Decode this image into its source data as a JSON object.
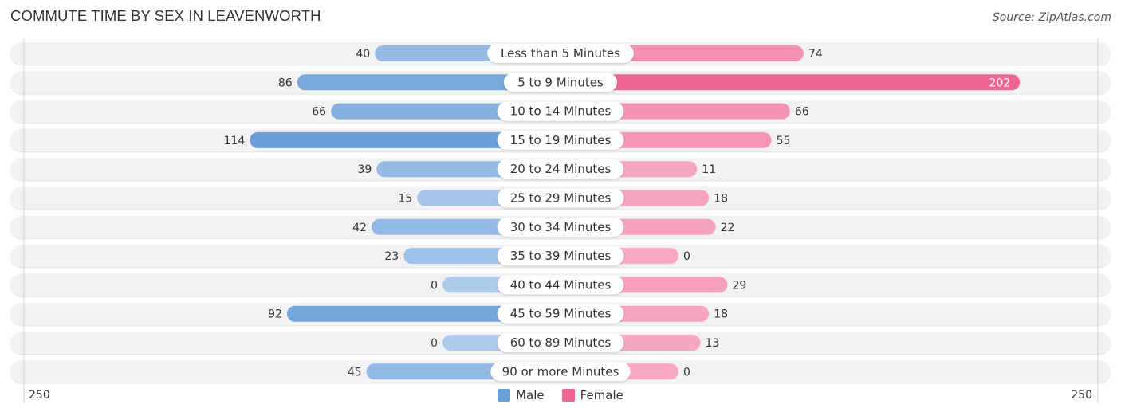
{
  "header": {
    "title": "COMMUTE TIME BY SEX IN LEAVENWORTH",
    "source": "Source: ZipAtlas.com"
  },
  "colors": {
    "male_strong": "#6a9fd8",
    "male_light": "#adcbec",
    "female_strong": "#f06592",
    "female_light": "#f7aac2",
    "row_bg": "#f2f2f2"
  },
  "chart_data": {
    "type": "bar",
    "orientation": "horizontal-diverging",
    "title": "COMMUTE TIME BY SEX IN LEAVENWORTH",
    "categories": [
      "Less than 5 Minutes",
      "5 to 9 Minutes",
      "10 to 14 Minutes",
      "15 to 19 Minutes",
      "20 to 24 Minutes",
      "25 to 29 Minutes",
      "30 to 34 Minutes",
      "35 to 39 Minutes",
      "40 to 44 Minutes",
      "45 to 59 Minutes",
      "60 to 89 Minutes",
      "90 or more Minutes"
    ],
    "series": [
      {
        "name": "Male",
        "values": [
          40,
          86,
          66,
          114,
          39,
          15,
          42,
          23,
          0,
          92,
          0,
          45
        ]
      },
      {
        "name": "Female",
        "values": [
          74,
          202,
          66,
          55,
          11,
          18,
          22,
          0,
          29,
          18,
          13,
          0
        ]
      }
    ],
    "axis": {
      "min_label": "250",
      "max_label": "250",
      "range": [
        -250,
        250
      ]
    },
    "legend": {
      "position": "bottom-center",
      "entries": [
        "Male",
        "Female"
      ]
    },
    "grid": false
  }
}
